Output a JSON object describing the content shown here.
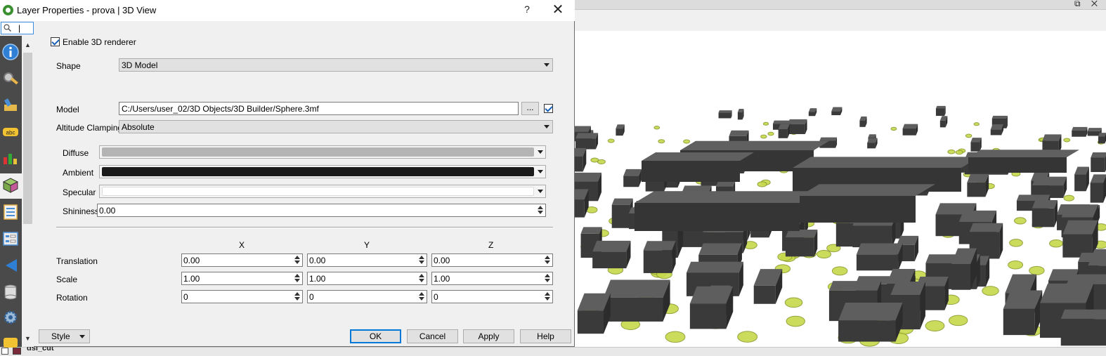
{
  "window": {
    "title": "Layer Properties - prova | 3D View",
    "help_label": "?",
    "close_label": "✕"
  },
  "sidebar": {
    "search_caret": "|",
    "icons": [
      "information-icon",
      "source-icon",
      "symbology-icon",
      "labels-icon",
      "diagrams-icon",
      "3d-view-icon",
      "fields-icon",
      "attributes-form-icon",
      "joins-icon",
      "auxiliary-storage-icon",
      "actions-icon",
      "display-icon"
    ]
  },
  "form": {
    "enable_label": "Enable 3D renderer",
    "enable_checked": true,
    "shape_label": "Shape",
    "shape_value": "3D Model",
    "model_label": "Model",
    "model_path": "C:/Users/user_02/3D Objects/3D Builder/Sphere.3mf",
    "browse_label": "...",
    "model_checked": true,
    "altitude_label": "Altitude Clamping",
    "altitude_value": "Absolute",
    "diffuse_label": "Diffuse",
    "diffuse_color": "#b4b4b4",
    "ambient_label": "Ambient",
    "ambient_color": "#1a1a1a",
    "specular_label": "Specular",
    "specular_color": "#ffffff",
    "shininess_label": "Shininess",
    "shininess_value": "0.00"
  },
  "transform": {
    "x_header": "X",
    "y_header": "Y",
    "z_header": "Z",
    "translation_label": "Translation",
    "translation": [
      "0.00",
      "0.00",
      "0.00"
    ],
    "scale_label": "Scale",
    "scale": [
      "1.00",
      "1.00",
      "1.00"
    ],
    "rotation_label": "Rotation",
    "rotation": [
      "0",
      "0",
      "0"
    ]
  },
  "buttons": {
    "style": "Style",
    "ok": "OK",
    "cancel": "Cancel",
    "apply": "Apply",
    "help": "Help"
  },
  "background": {
    "window_controls": "⧉ ✕",
    "layer_name": "dsl_cut",
    "layer_color": "#7a2a3a"
  }
}
